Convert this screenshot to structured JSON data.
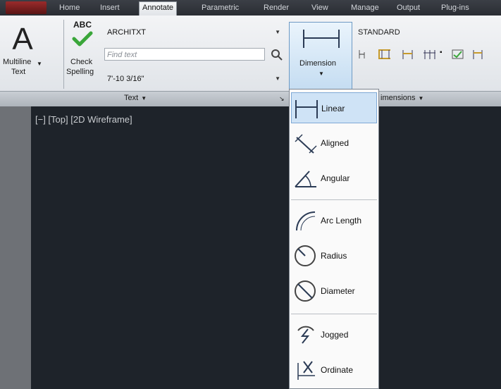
{
  "tabs": [
    "Home",
    "Insert",
    "Annotate",
    "Parametric",
    "Render",
    "View",
    "Manage",
    "Output",
    "Plug-ins"
  ],
  "active_tab": "Annotate",
  "text_panel": {
    "multiline_text": [
      "Multiline",
      "Text"
    ],
    "check_spelling": [
      "Check",
      "Spelling"
    ],
    "abc_label": "ABC",
    "text_style": "ARCHITXT",
    "find_text_placeholder": "Find text",
    "text_height": "7'-10 3/16\"",
    "footer": "Text"
  },
  "dimensions_panel": {
    "dimension_button": "Dimension",
    "dim_style": "STANDARD",
    "footer": "imensions"
  },
  "viewport_label": "[−] [Top] [2D Wireframe]",
  "dimension_menu": [
    {
      "label": "Linear",
      "icon": "linear-dimension-icon",
      "selected": true
    },
    {
      "label": "Aligned",
      "icon": "aligned-dimension-icon",
      "selected": false
    },
    {
      "label": "Angular",
      "icon": "angular-dimension-icon",
      "selected": false
    },
    {
      "label": "Arc Length",
      "icon": "arc-length-icon",
      "selected": false
    },
    {
      "label": "Radius",
      "icon": "radius-icon",
      "selected": false
    },
    {
      "label": "Diameter",
      "icon": "diameter-icon",
      "selected": false
    },
    {
      "label": "Jogged",
      "icon": "jogged-icon",
      "selected": false
    },
    {
      "label": "Ordinate",
      "icon": "ordinate-icon",
      "selected": false
    }
  ],
  "colors": {
    "accent": "#cfe3f6",
    "viewport": "#1e232a",
    "check": "#3aa63a"
  }
}
